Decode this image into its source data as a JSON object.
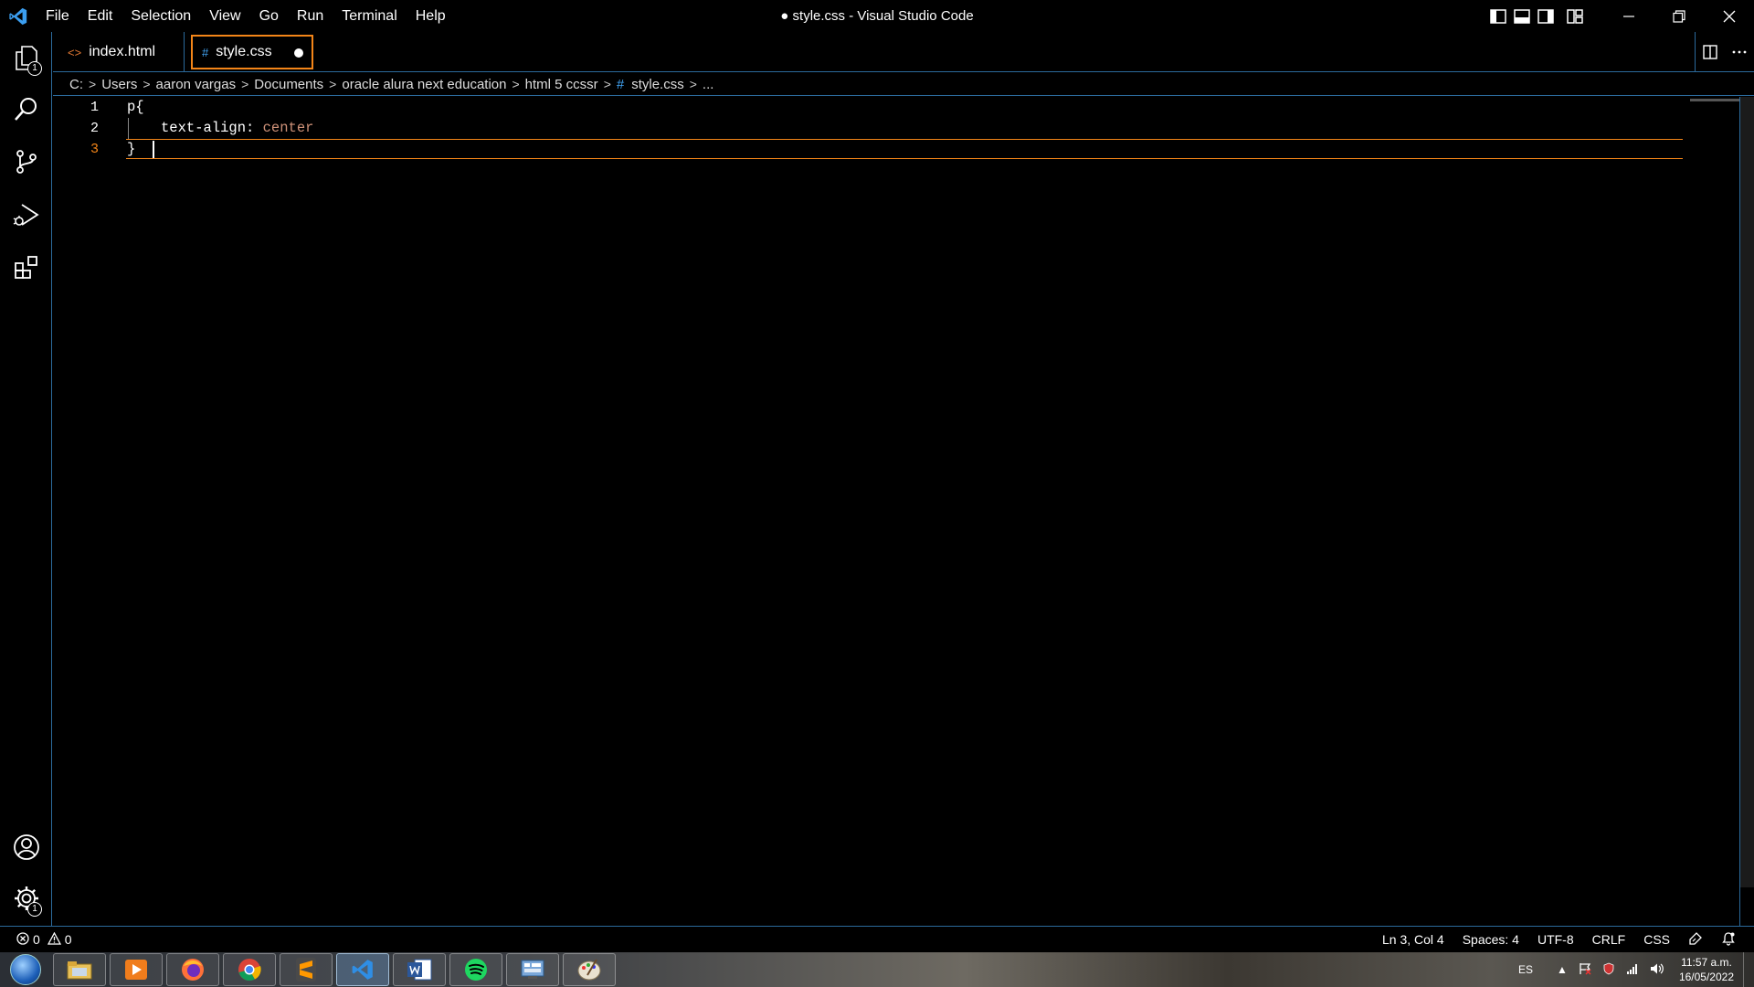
{
  "titlebar": {
    "app_icon": "vscode-logo-icon",
    "menu": [
      "File",
      "Edit",
      "Selection",
      "View",
      "Go",
      "Run",
      "Terminal",
      "Help"
    ],
    "window_title": "● style.css - Visual Studio Code"
  },
  "activity_bar": {
    "items": [
      {
        "name": "explorer-icon",
        "badge": "1"
      },
      {
        "name": "search-icon"
      },
      {
        "name": "source-control-icon"
      },
      {
        "name": "run-debug-icon"
      },
      {
        "name": "extensions-icon"
      }
    ],
    "bottom": [
      {
        "name": "account-icon"
      },
      {
        "name": "manage-gear-icon",
        "badge": "1"
      }
    ]
  },
  "tabs": [
    {
      "label": "index.html",
      "icon": "<>",
      "active": false
    },
    {
      "label": "style.css",
      "icon": "#",
      "active": true,
      "dirty": true
    }
  ],
  "breadcrumb": [
    "C:",
    "Users",
    "aaron vargas",
    "Documents",
    "oracle alura next education",
    "html 5 ccssr",
    "style.css",
    "..."
  ],
  "breadcrumb_file_icon": "#",
  "editor": {
    "lines": [
      {
        "num": "1",
        "selector": "p{"
      },
      {
        "num": "2",
        "property": "text-align",
        "colon": ": ",
        "value": "center"
      },
      {
        "num": "3",
        "text": "}"
      }
    ]
  },
  "status": {
    "errors": "0",
    "warnings": "0",
    "position": "Ln 3, Col 4",
    "spaces": "Spaces: 4",
    "encoding": "UTF-8",
    "eol": "CRLF",
    "language": "CSS"
  },
  "taskbar": {
    "apps": [
      "file-explorer",
      "media-player",
      "firefox",
      "chrome",
      "sublime-text",
      "vscode",
      "word",
      "spotify",
      "control-panel",
      "paint"
    ],
    "language": "ES",
    "time": "11:57 a.m.",
    "date": "16/05/2022"
  },
  "colors": {
    "focus_border": "#f38518",
    "contrast_border": "#2b6a9c",
    "string_value": "#ce9178"
  }
}
